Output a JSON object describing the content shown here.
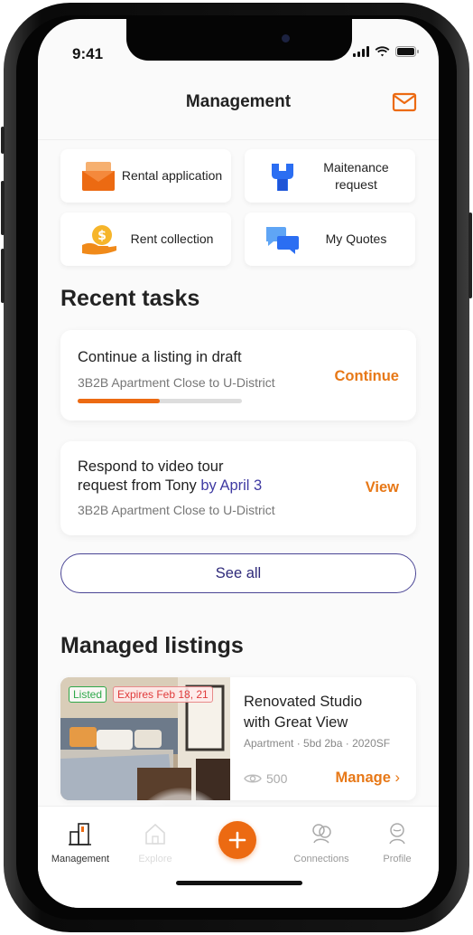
{
  "status_bar": {
    "time": "9:41"
  },
  "header": {
    "title": "Management",
    "mail_icon": "mail-icon"
  },
  "quick_actions": [
    {
      "label": "Rental application",
      "icon": "envelope-icon"
    },
    {
      "label": "Maitenance request",
      "icon": "wrench-icon"
    },
    {
      "label": "Rent collection",
      "icon": "coin-hand-icon"
    },
    {
      "label": "My Quotes",
      "icon": "chat-bubbles-icon"
    }
  ],
  "recent_tasks": {
    "title": "Recent tasks",
    "items": [
      {
        "title": "Continue a listing in draft",
        "subtitle": "3B2B Apartment Close to U-District",
        "action": "Continue",
        "progress": 0.5
      },
      {
        "title_line1": "Respond to video tour",
        "title_line2": "request from Tony",
        "highlight": "by April 3",
        "subtitle": "3B2B Apartment Close to U-District",
        "action": "View"
      }
    ],
    "see_all": "See all"
  },
  "managed_listings": {
    "title": "Managed listings",
    "items": [
      {
        "badge_listed": "Listed",
        "badge_expires": "Expires Feb 18, 21",
        "title_line1": "Renovated Studio",
        "title_line2": "with Great View",
        "meta": "Apartment · 5bd 2ba · 2020SF",
        "views": "500",
        "action": "Manage"
      }
    ]
  },
  "tabbar": {
    "tabs": [
      {
        "label": "Management",
        "active": true
      },
      {
        "label": "Explore",
        "active": false
      },
      {
        "label": "Connections",
        "active": false
      },
      {
        "label": "Profile",
        "active": false
      }
    ]
  },
  "colors": {
    "accent": "#ec6a12",
    "primary_dark": "#3f3aa2"
  }
}
